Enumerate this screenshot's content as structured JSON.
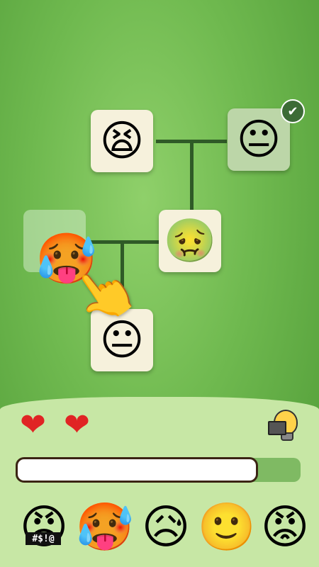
{
  "board": {
    "cards": [
      {
        "name": "card-vomiting-squint",
        "emoji": "😫",
        "state": "filled"
      },
      {
        "name": "card-neutral",
        "emoji": "😐",
        "state": "matched"
      },
      {
        "name": "card-vomiting",
        "emoji": "🤢",
        "state": "filled"
      },
      {
        "name": "card-hot-sweat",
        "emoji": "🥵",
        "state": "dragging"
      },
      {
        "name": "card-hot-neutral",
        "emoji": "😐",
        "state": "filled"
      }
    ],
    "matched_check": "✔"
  },
  "lives": {
    "hearts": [
      "❤",
      "❤"
    ]
  },
  "progress": {
    "value": 0.85
  },
  "choices": [
    {
      "emoji": "😠",
      "caption": "#$!@"
    },
    {
      "emoji": "🥵"
    },
    {
      "emoji": "😥"
    },
    {
      "emoji": "🙂"
    },
    {
      "emoji": "😡"
    }
  ],
  "icons": {
    "hint": "lightbulb-video-icon",
    "hand": "pointing-hand-icon"
  }
}
